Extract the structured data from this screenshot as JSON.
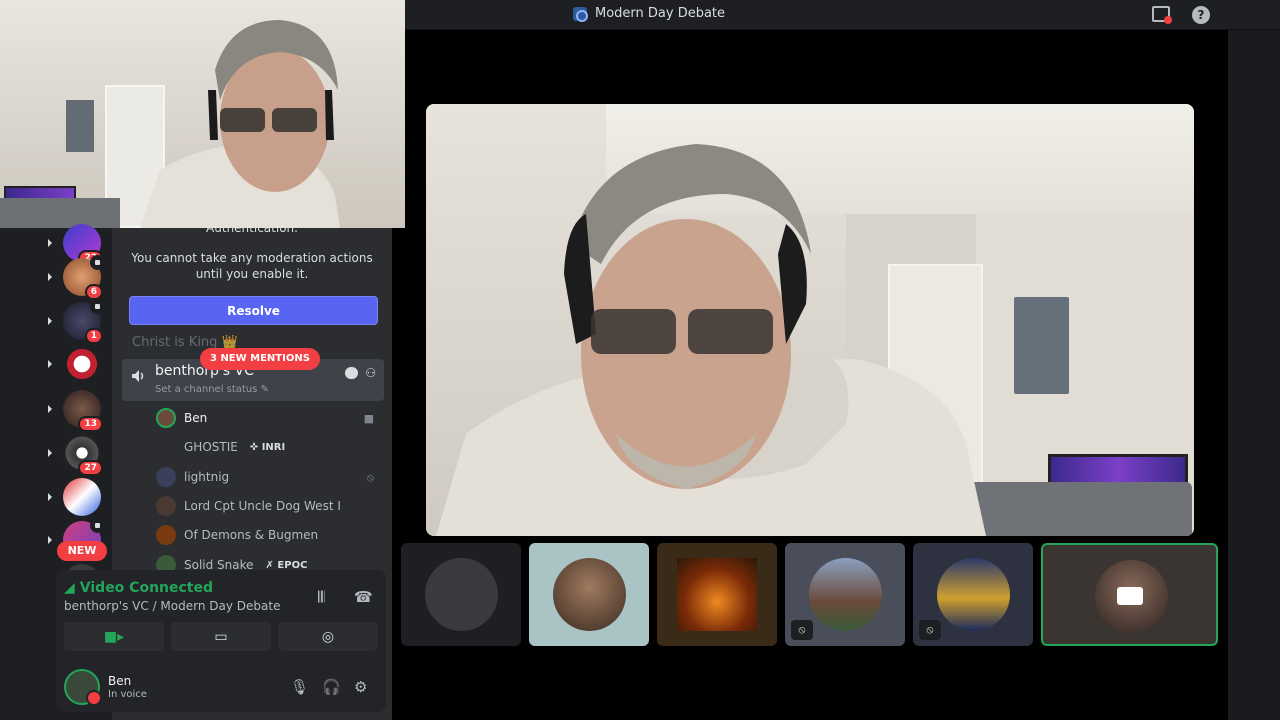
{
  "window": {
    "title": "Modern Day Debate"
  },
  "notice": {
    "cut_text": "Authentication.",
    "message": "You cannot take any moderation actions until you enable it.",
    "resolve_label": "Resolve"
  },
  "servers": [
    {
      "badge": "22"
    },
    {
      "badge": "6"
    },
    {
      "badge": "1"
    },
    {
      "badge": ""
    },
    {
      "badge": "13"
    },
    {
      "badge": "27"
    },
    {
      "badge": ""
    },
    {
      "badge": ""
    }
  ],
  "rail": {
    "new_label": "NEW"
  },
  "channels": {
    "faded": "Christ is King 👑",
    "mentions_label": "3 NEW MENTIONS",
    "voice_channel": {
      "name": "benthorp's VC",
      "status": "Set a channel status ✎"
    }
  },
  "members": [
    {
      "name": "Ben",
      "tag": "",
      "color": "#6b4a3a"
    },
    {
      "name": "GHOSTIE",
      "tag": "✜ INRI",
      "color": ""
    },
    {
      "name": "lightnig",
      "tag": "",
      "color": "#3a3f5a"
    },
    {
      "name": "Lord Cpt Uncle Dog West I",
      "tag": "",
      "color": "#4a3a32"
    },
    {
      "name": "Of Demons & Bugmen",
      "tag": "",
      "color": "#7a3a10"
    },
    {
      "name": "Solid Snake",
      "tag": "✗ EPOC",
      "color": "#3a5a3a"
    }
  ],
  "voice_panel": {
    "status": "Video Connected",
    "location": "benthorp's VC / Modern Day Debate",
    "user_name": "Ben",
    "user_state": "In voice"
  },
  "icons": {
    "server": "server-logo-icon",
    "screen": "screen-share-status-icon",
    "help": "help-icon",
    "camera": "camera-icon",
    "share": "screen-share-icon",
    "activity": "activity-gamepad-icon",
    "mic": "microphone-icon",
    "headset": "headset-icon",
    "settings": "gear-icon"
  },
  "colors": {
    "accent": "#5865f2",
    "danger": "#f23f43",
    "online": "#23a55a",
    "sidebar": "#2b2d31"
  }
}
